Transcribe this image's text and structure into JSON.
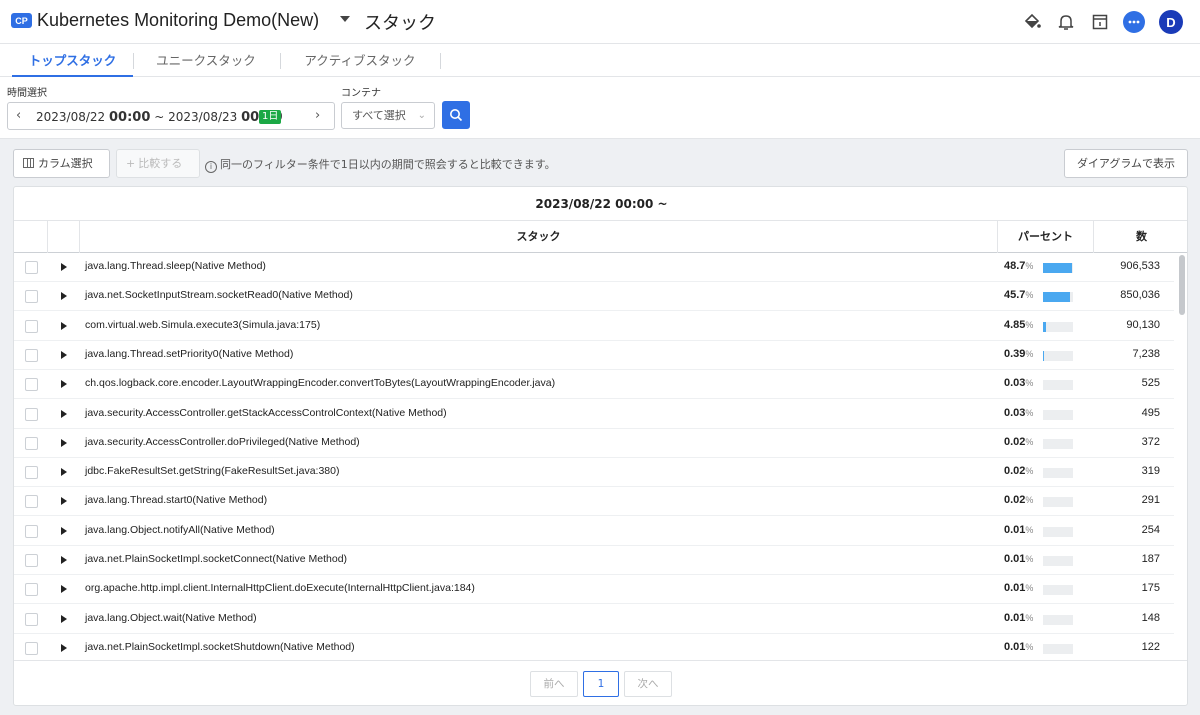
{
  "header": {
    "badge": "CP",
    "project": "Kubernetes Monitoring Demo(New)",
    "title": "スタック",
    "avatar": "D"
  },
  "tabs": [
    {
      "label": "トップスタック",
      "active": true
    },
    {
      "label": "ユニークスタック",
      "active": false
    },
    {
      "label": "アクティブスタック",
      "active": false
    }
  ],
  "filters": {
    "time_label": "時間選択",
    "time_start_date": "2023/08/22",
    "time_start_time": "00:00",
    "time_sep": "~",
    "time_end_date": "2023/08/23",
    "time_end_time": "00:00",
    "duration": "1日",
    "container_label": "コンテナ",
    "container_value": "すべて選択"
  },
  "toolbar": {
    "column_select": "カラム選択",
    "compare": "比較する",
    "info": "同一のフィルター条件で1日以内の期間で照会すると比較できます。",
    "diagram": "ダイアグラムで表示"
  },
  "table": {
    "date_header": "2023/08/22 00:00 ~",
    "columns": {
      "stack": "スタック",
      "percent": "パーセント",
      "count": "数"
    },
    "rows": [
      {
        "stack": "java.lang.Thread.sleep(Native Method)",
        "percent": "48.7",
        "ratio": 0.487,
        "count": "906,533"
      },
      {
        "stack": "java.net.SocketInputStream.socketRead0(Native Method)",
        "percent": "45.7",
        "ratio": 0.457,
        "count": "850,036"
      },
      {
        "stack": "com.virtual.web.Simula.execute3(Simula.java:175)",
        "percent": "4.85",
        "ratio": 0.0485,
        "count": "90,130"
      },
      {
        "stack": "java.lang.Thread.setPriority0(Native Method)",
        "percent": "0.39",
        "ratio": 0.0039,
        "count": "7,238"
      },
      {
        "stack": "ch.qos.logback.core.encoder.LayoutWrappingEncoder.convertToBytes(LayoutWrappingEncoder.java)",
        "percent": "0.03",
        "ratio": 0.0003,
        "count": "525"
      },
      {
        "stack": "java.security.AccessController.getStackAccessControlContext(Native Method)",
        "percent": "0.03",
        "ratio": 0.0003,
        "count": "495"
      },
      {
        "stack": "java.security.AccessController.doPrivileged(Native Method)",
        "percent": "0.02",
        "ratio": 0.0002,
        "count": "372"
      },
      {
        "stack": "jdbc.FakeResultSet.getString(FakeResultSet.java:380)",
        "percent": "0.02",
        "ratio": 0.0002,
        "count": "319"
      },
      {
        "stack": "java.lang.Thread.start0(Native Method)",
        "percent": "0.02",
        "ratio": 0.0002,
        "count": "291"
      },
      {
        "stack": "java.lang.Object.notifyAll(Native Method)",
        "percent": "0.01",
        "ratio": 0.0001,
        "count": "254"
      },
      {
        "stack": "java.net.PlainSocketImpl.socketConnect(Native Method)",
        "percent": "0.01",
        "ratio": 0.0001,
        "count": "187"
      },
      {
        "stack": "org.apache.http.impl.client.InternalHttpClient.doExecute(InternalHttpClient.java:184)",
        "percent": "0.01",
        "ratio": 0.0001,
        "count": "175"
      },
      {
        "stack": "java.lang.Object.wait(Native Method)",
        "percent": "0.01",
        "ratio": 0.0001,
        "count": "148"
      },
      {
        "stack": "java.net.PlainSocketImpl.socketShutdown(Native Method)",
        "percent": "0.01",
        "ratio": 0.0001,
        "count": "122"
      }
    ]
  },
  "pagination": {
    "prev": "前へ",
    "current": "1",
    "next": "次へ"
  },
  "colors": {
    "accent": "#2f6fe4",
    "bar": "#4aa8f0",
    "badge_green": "#1ba845"
  }
}
